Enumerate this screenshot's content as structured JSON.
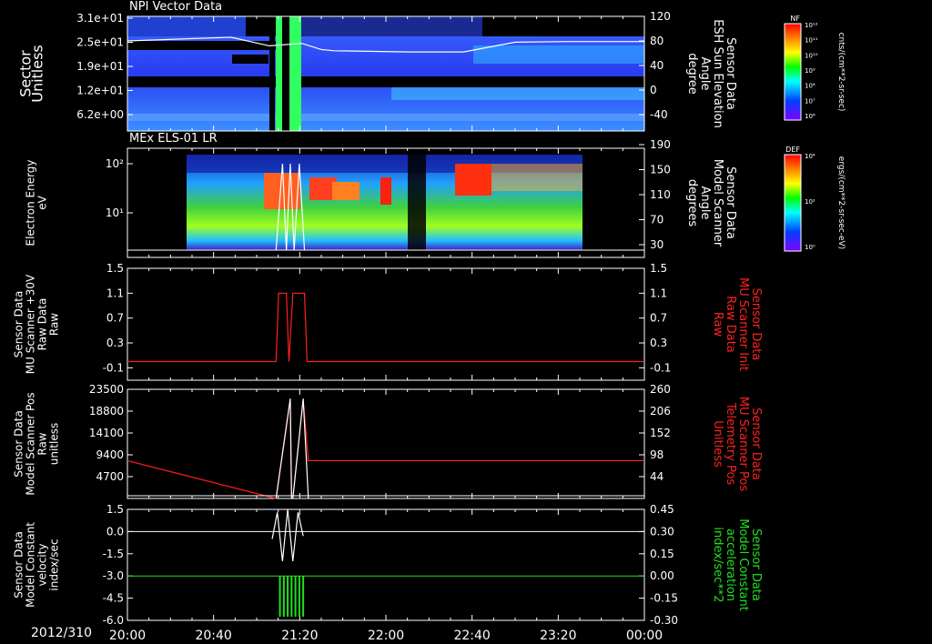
{
  "header": {
    "date_label": "2012/310"
  },
  "time_axis": {
    "ticks": [
      "20:00",
      "20:40",
      "21:20",
      "22:00",
      "22:40",
      "23:20",
      "00:00"
    ]
  },
  "colors": {
    "white": "#ffffff",
    "red": "#ff2020",
    "green": "#20e020"
  },
  "colorbars": [
    {
      "title": "NF",
      "unit": "cnts/(cm**2-sr-sec)",
      "ticks": [
        "10¹²",
        "10¹¹",
        "10¹⁰",
        "10⁹",
        "10⁸",
        "10⁷",
        "10⁶"
      ]
    },
    {
      "title": "DEF",
      "unit": "ergs/(cm**2-sr-sec-eV)",
      "ticks": [
        "10⁴",
        "10²",
        "10⁰"
      ]
    }
  ],
  "chart_data": [
    {
      "type": "heatmap",
      "title": "NPI Vector Data",
      "ylabel": [
        "Sector",
        "Unitless"
      ],
      "yticks": [
        "3.1e+01",
        "2.5e+01",
        "1.9e+01",
        "1.2e+01",
        "6.2e+00"
      ],
      "ylabel_right": [
        "Sensor Data",
        "ESH Sun Elevation",
        "Angle",
        "degree"
      ],
      "yticks_right": [
        "120",
        "80",
        "40",
        "0",
        "-40"
      ],
      "overlay_line": {
        "name": "ESH Sun Elevation Angle",
        "x_hours": [
          0,
          0.8,
          1.1,
          1.35,
          1.5,
          1.6,
          2.2,
          2.6,
          3.0,
          3.4,
          4.0
        ],
        "y": [
          80,
          86,
          72,
          76,
          66,
          64,
          62,
          62,
          78,
          79,
          79
        ]
      }
    },
    {
      "type": "heatmap",
      "title": "MEx ELS-01 LR",
      "ylabel": [
        "Electron Energy",
        "eV"
      ],
      "yticks": [
        "10²",
        "10¹"
      ],
      "ylabel_right": [
        "Sensor Data",
        "Model Scanner",
        "Angle",
        "degrees"
      ],
      "yticks_right": [
        "190",
        "150",
        "110",
        "70",
        "30"
      ],
      "x_data_range_hours": [
        0.5,
        3.5
      ]
    },
    {
      "type": "line",
      "ylabel": [
        "Sensor Data",
        "MU Scanner +30V",
        "Raw Data",
        "Raw"
      ],
      "yticks": [
        "1.5",
        "1.1",
        "0.7",
        "0.3",
        "-0.1"
      ],
      "ylabel_right": [
        "Sensor Data",
        "MU Scanner Init",
        "Raw Data",
        "Raw"
      ],
      "yticks_right": [
        "1.5",
        "1.1",
        "0.7",
        "0.3",
        "-0.1"
      ],
      "ylim": [
        -0.3,
        1.5
      ],
      "series": [
        {
          "name": "MU Scanner Init",
          "x_hours": [
            0,
            1.15,
            1.17,
            1.23,
            1.25,
            1.28,
            1.3,
            1.37,
            1.39,
            4
          ],
          "y": [
            0,
            0,
            1.1,
            1.1,
            0,
            1.1,
            1.1,
            1.1,
            0,
            0
          ]
        }
      ]
    },
    {
      "type": "line",
      "ylabel": [
        "Sensor Data",
        "Model Scanner Pos",
        "Raw",
        "unitless"
      ],
      "yticks": [
        "23500",
        "18800",
        "14100",
        "9400",
        "4700"
      ],
      "ylabel_right": [
        "Sensor Data",
        "MU Scanner Pos",
        "Telemetry Pos",
        "Unitless"
      ],
      "yticks_right": [
        "260",
        "206",
        "152",
        "98",
        "44"
      ],
      "series": [
        {
          "name": "Model Scanner Pos",
          "x_hours": [
            1.15,
            1.26,
            1.27,
            1.28,
            1.36,
            1.4
          ],
          "y": [
            0,
            21500,
            0,
            0,
            21500,
            0
          ]
        },
        {
          "name": "MU Scanner Pos",
          "x_hours": [
            0,
            1.15,
            1.26,
            1.27,
            1.28,
            1.36,
            1.4,
            4
          ],
          "y": [
            90,
            0,
            235,
            0,
            0,
            235,
            90,
            90
          ]
        }
      ]
    },
    {
      "type": "line",
      "ylabel": [
        "Sensor Data",
        "Model Constant",
        "velocity",
        "index/sec"
      ],
      "yticks": [
        "1.5",
        "0.0",
        "-1.5",
        "-3.0",
        "-4.5",
        "-6.0"
      ],
      "ylabel_right": [
        "Sensor Data",
        "Model Constant",
        "acceleration",
        "index/sec**2"
      ],
      "yticks_right": [
        "0.45",
        "0.30",
        "0.15",
        "0.00",
        "-0.15",
        "-0.30"
      ],
      "series": [
        {
          "name": "Model Constant velocity",
          "y_constant": 0.0
        },
        {
          "name": "Model Constant acceleration",
          "y_constant": 0.0
        }
      ]
    }
  ]
}
